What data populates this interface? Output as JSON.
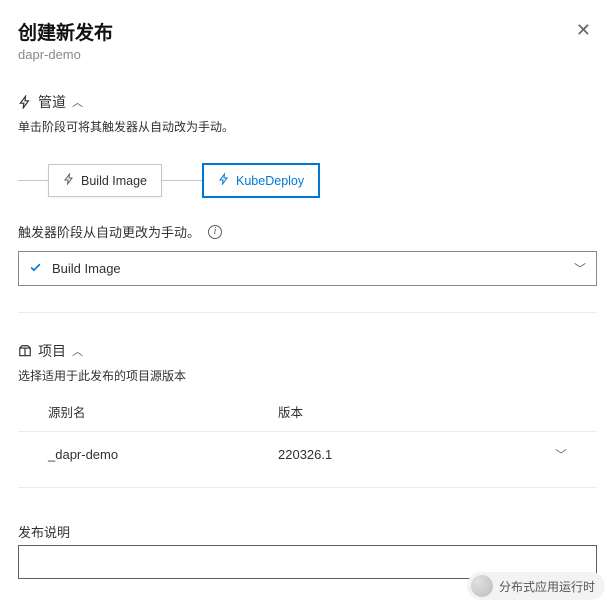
{
  "header": {
    "title": "创建新发布",
    "subtitle": "dapr-demo"
  },
  "pipeline": {
    "label": "管道",
    "desc": "单击阶段可将其触发器从自动改为手动。",
    "stages": [
      {
        "name": "Build Image",
        "active": false
      },
      {
        "name": "KubeDeploy",
        "active": true
      }
    ],
    "trigger_label": "触发器阶段从自动更改为手动。",
    "selected_stage": "Build Image"
  },
  "project": {
    "label": "项目",
    "desc": "选择适用于此发布的项目源版本",
    "columns": {
      "alias": "源别名",
      "version": "版本"
    },
    "rows": [
      {
        "alias": "_dapr-demo",
        "version": "220326.1"
      }
    ]
  },
  "release_desc": {
    "label": "发布说明",
    "value": ""
  },
  "footer": {
    "badge": "分布式应用运行时"
  }
}
